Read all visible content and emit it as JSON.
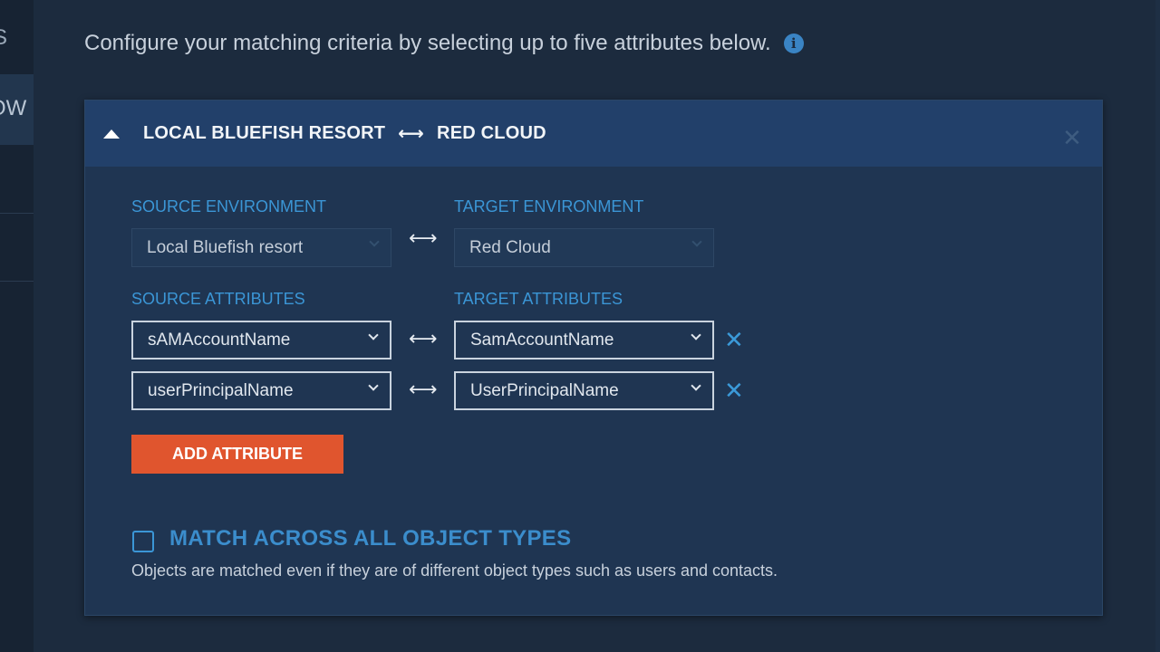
{
  "left_nav": {
    "items": [
      "S",
      "OW"
    ]
  },
  "intro": {
    "text": "Configure your matching criteria by selecting up to five attributes below.",
    "info_icon": "info-icon"
  },
  "panel": {
    "title_source": "LOCAL BLUEFISH RESORT",
    "title_arrow": "⟷",
    "title_target": "RED CLOUD",
    "close_icon": "close-icon"
  },
  "environments": {
    "source_label": "SOURCE ENVIRONMENT",
    "target_label": "TARGET ENVIRONMENT",
    "source_value": "Local Bluefish resort",
    "target_value": "Red Cloud"
  },
  "attributes": {
    "source_label": "SOURCE ATTRIBUTES",
    "target_label": "TARGET ATTRIBUTES",
    "rows": [
      {
        "source": "sAMAccountName",
        "target": "SamAccountName"
      },
      {
        "source": "userPrincipalName",
        "target": "UserPrincipalName"
      }
    ],
    "swap_glyph": "⟷",
    "remove_glyph": "✕"
  },
  "add_button": {
    "label": "ADD ATTRIBUTE"
  },
  "match_all": {
    "label": "MATCH ACROSS ALL OBJECT TYPES",
    "description": "Objects are matched even if they are of different object types such as users and contacts.",
    "checked": false
  },
  "colors": {
    "accent_blue": "#3b96d6",
    "button_orange": "#e0552e",
    "panel_bg": "#1f3552",
    "header_bg": "#22406a"
  }
}
